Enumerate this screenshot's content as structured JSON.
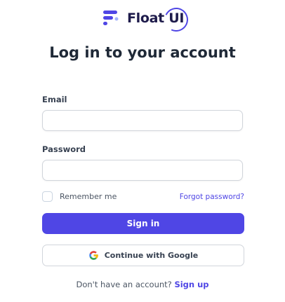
{
  "brand": {
    "name": "Float UI"
  },
  "heading": "Log in to your account",
  "form": {
    "email_label": "Email",
    "email_value": "",
    "password_label": "Password",
    "password_value": "",
    "remember_label": "Remember me",
    "forgot_link": "Forgot password?",
    "signin_button": "Sign in",
    "google_button": "Continue with Google"
  },
  "footer": {
    "prompt": "Don't have an account?",
    "signup_link": "Sign up"
  },
  "colors": {
    "accent": "#4f46e5",
    "text": "#1f2937",
    "border": "#d1d5db"
  },
  "icons": [
    "float-ui-logo-icon",
    "google-icon"
  ]
}
